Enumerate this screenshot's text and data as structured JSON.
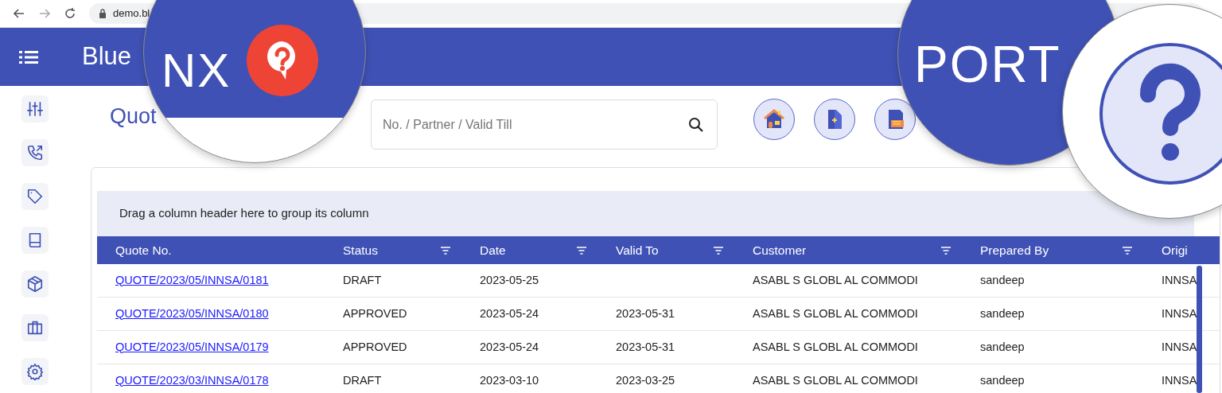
{
  "browser": {
    "url": "demo.bl"
  },
  "header": {
    "title": "Blue"
  },
  "page": {
    "title": "Quot",
    "search": {
      "placeholder": "No. / Partner / Valid Till"
    }
  },
  "group_panel": "Drag a column header here to group its column",
  "table": {
    "columns": [
      {
        "label": "Quote No.",
        "filter": false
      },
      {
        "label": "Status",
        "filter": true
      },
      {
        "label": "Date",
        "filter": true
      },
      {
        "label": "Valid To",
        "filter": true
      },
      {
        "label": "Customer",
        "filter": true
      },
      {
        "label": "Prepared By",
        "filter": true
      },
      {
        "label": "Origi"
      }
    ],
    "rows": [
      [
        "QUOTE/2023/05/INNSA/0181",
        "DRAFT",
        "2023-05-25",
        "",
        "ASABL S GLOBL AL COMMODI",
        "sandeep",
        "INNSA"
      ],
      [
        "QUOTE/2023/05/INNSA/0180",
        "APPROVED",
        "2023-05-24",
        "2023-05-31",
        "ASABL S GLOBL AL COMMODI",
        "sandeep",
        "INNSA"
      ],
      [
        "QUOTE/2023/05/INNSA/0179",
        "APPROVED",
        "2023-05-24",
        "2023-05-31",
        "ASABL S GLOBL AL COMMODI",
        "sandeep",
        "INNSA"
      ],
      [
        "QUOTE/2023/03/INNSA/0178",
        "DRAFT",
        "2023-03-10",
        "2023-03-25",
        "ASABL S GLOBL AL COMMODI",
        "sandeep",
        "INNSA"
      ]
    ]
  },
  "lenses": [
    {
      "kind": "text-help",
      "text": "NX"
    },
    {
      "kind": "text",
      "text": "PORT"
    },
    {
      "kind": "help"
    }
  ]
}
